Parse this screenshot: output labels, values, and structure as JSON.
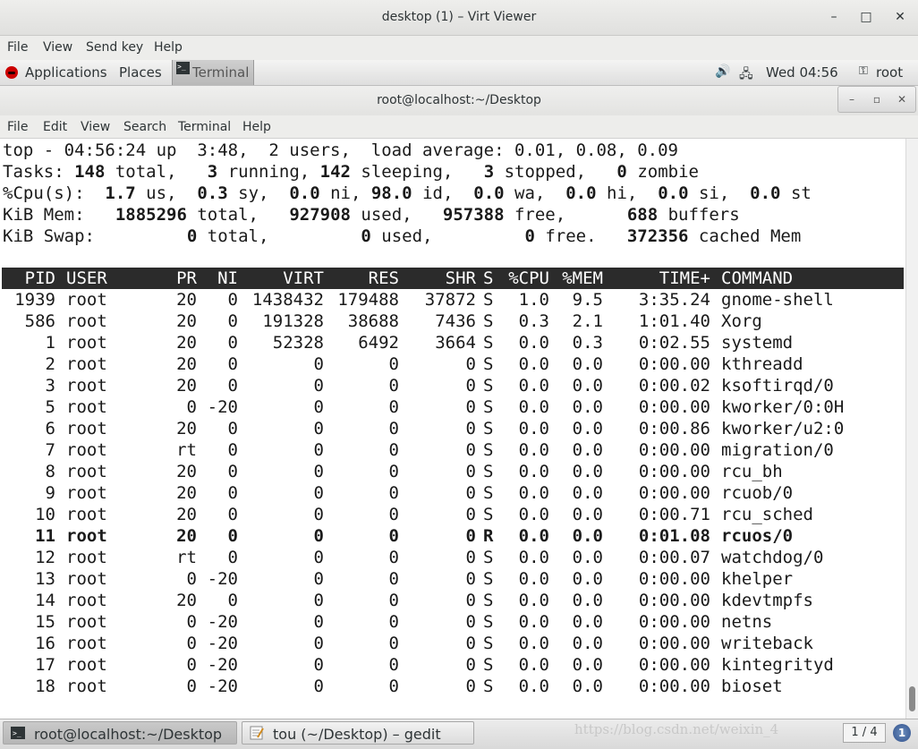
{
  "viewer": {
    "title": "desktop (1) – Virt Viewer",
    "menu": [
      "File",
      "View",
      "Send key",
      "Help"
    ],
    "minimize": "–",
    "maximize": "□",
    "close": "✕"
  },
  "panel": {
    "applications": "Applications",
    "places": "Places",
    "terminal_task": "Terminal",
    "clock": "Wed 04:56",
    "user": "root"
  },
  "terminal": {
    "title": "root@localhost:~/Desktop",
    "menu": [
      "File",
      "Edit",
      "View",
      "Search",
      "Terminal",
      "Help"
    ],
    "summary": {
      "line1": "top - 04:56:24 up  3:48,  2 users,  load average: 0.01, 0.08, 0.09",
      "line2_prefix": "Tasks: ",
      "tasks_total": "148",
      "line2_a": " total,   ",
      "tasks_running": "3",
      "line2_b": " running, ",
      "tasks_sleeping": "142",
      "line2_c": " sleeping,   ",
      "tasks_stopped": "3",
      "line2_d": " stopped,   ",
      "tasks_zombie": "0",
      "line2_e": " zombie",
      "cpu_prefix": "%Cpu(s):  ",
      "cpu_us": "1.7",
      "cpu_a": " us,  ",
      "cpu_sy": "0.3",
      "cpu_b": " sy,  ",
      "cpu_ni": "0.0",
      "cpu_c": " ni, ",
      "cpu_id": "98.0",
      "cpu_d": " id,  ",
      "cpu_wa": "0.0",
      "cpu_e": " wa,  ",
      "cpu_hi": "0.0",
      "cpu_f": " hi,  ",
      "cpu_si": "0.0",
      "cpu_g": " si,  ",
      "cpu_st": "0.0",
      "cpu_h": " st",
      "mem_prefix": "KiB Mem:   ",
      "mem_total": "1885296",
      "mem_a": " total,   ",
      "mem_used": "927908",
      "mem_b": " used,   ",
      "mem_free": "957388",
      "mem_c": " free,      ",
      "mem_buffers": "688",
      "mem_d": " buffers",
      "swap_prefix": "KiB Swap:         ",
      "swap_total": "0",
      "swap_a": " total,         ",
      "swap_used": "0",
      "swap_b": " used,         ",
      "swap_free": "0",
      "swap_c": " free.   ",
      "swap_cached": "372356",
      "swap_d": " cached Mem"
    },
    "columns": [
      "PID",
      "USER",
      "PR",
      "NI",
      "VIRT",
      "RES",
      "SHR",
      "S",
      "%CPU",
      "%MEM",
      "TIME+",
      "COMMAND"
    ],
    "processes": [
      [
        "1939",
        "root",
        "20",
        "0",
        "1438432",
        "179488",
        "37872",
        "S",
        "1.0",
        "9.5",
        "3:35.24",
        "gnome-shell"
      ],
      [
        "586",
        "root",
        "20",
        "0",
        "191328",
        "38688",
        "7436",
        "S",
        "0.3",
        "2.1",
        "1:01.40",
        "Xorg"
      ],
      [
        "1",
        "root",
        "20",
        "0",
        "52328",
        "6492",
        "3664",
        "S",
        "0.0",
        "0.3",
        "0:02.55",
        "systemd"
      ],
      [
        "2",
        "root",
        "20",
        "0",
        "0",
        "0",
        "0",
        "S",
        "0.0",
        "0.0",
        "0:00.00",
        "kthreadd"
      ],
      [
        "3",
        "root",
        "20",
        "0",
        "0",
        "0",
        "0",
        "S",
        "0.0",
        "0.0",
        "0:00.02",
        "ksoftirqd/0"
      ],
      [
        "5",
        "root",
        "0",
        "-20",
        "0",
        "0",
        "0",
        "S",
        "0.0",
        "0.0",
        "0:00.00",
        "kworker/0:0H"
      ],
      [
        "6",
        "root",
        "20",
        "0",
        "0",
        "0",
        "0",
        "S",
        "0.0",
        "0.0",
        "0:00.86",
        "kworker/u2:0"
      ],
      [
        "7",
        "root",
        "rt",
        "0",
        "0",
        "0",
        "0",
        "S",
        "0.0",
        "0.0",
        "0:00.00",
        "migration/0"
      ],
      [
        "8",
        "root",
        "20",
        "0",
        "0",
        "0",
        "0",
        "S",
        "0.0",
        "0.0",
        "0:00.00",
        "rcu_bh"
      ],
      [
        "9",
        "root",
        "20",
        "0",
        "0",
        "0",
        "0",
        "S",
        "0.0",
        "0.0",
        "0:00.00",
        "rcuob/0"
      ],
      [
        "10",
        "root",
        "20",
        "0",
        "0",
        "0",
        "0",
        "S",
        "0.0",
        "0.0",
        "0:00.71",
        "rcu_sched"
      ],
      [
        "11",
        "root",
        "20",
        "0",
        "0",
        "0",
        "0",
        "R",
        "0.0",
        "0.0",
        "0:01.08",
        "rcuos/0"
      ],
      [
        "12",
        "root",
        "rt",
        "0",
        "0",
        "0",
        "0",
        "S",
        "0.0",
        "0.0",
        "0:00.07",
        "watchdog/0"
      ],
      [
        "13",
        "root",
        "0",
        "-20",
        "0",
        "0",
        "0",
        "S",
        "0.0",
        "0.0",
        "0:00.00",
        "khelper"
      ],
      [
        "14",
        "root",
        "20",
        "0",
        "0",
        "0",
        "0",
        "S",
        "0.0",
        "0.0",
        "0:00.00",
        "kdevtmpfs"
      ],
      [
        "15",
        "root",
        "0",
        "-20",
        "0",
        "0",
        "0",
        "S",
        "0.0",
        "0.0",
        "0:00.00",
        "netns"
      ],
      [
        "16",
        "root",
        "0",
        "-20",
        "0",
        "0",
        "0",
        "S",
        "0.0",
        "0.0",
        "0:00.00",
        "writeback"
      ],
      [
        "17",
        "root",
        "0",
        "-20",
        "0",
        "0",
        "0",
        "S",
        "0.0",
        "0.0",
        "0:00.00",
        "kintegrityd"
      ],
      [
        "18",
        "root",
        "0",
        "-20",
        "0",
        "0",
        "0",
        "S",
        "0.0",
        "0.0",
        "0:00.00",
        "bioset"
      ]
    ],
    "highlight_row": "11"
  },
  "taskbar": {
    "tasks": [
      "root@localhost:~/Desktop",
      "tou (~/Desktop) – gedit"
    ],
    "watermark": "https://blog.csdn.net/weixin_4",
    "pager": "1 / 4"
  },
  "colors": {
    "header_bg": "#2b2b2b",
    "header_fg": "#ffffff",
    "terminal_bg": "#ffffff",
    "redhat": "#cc0000"
  }
}
